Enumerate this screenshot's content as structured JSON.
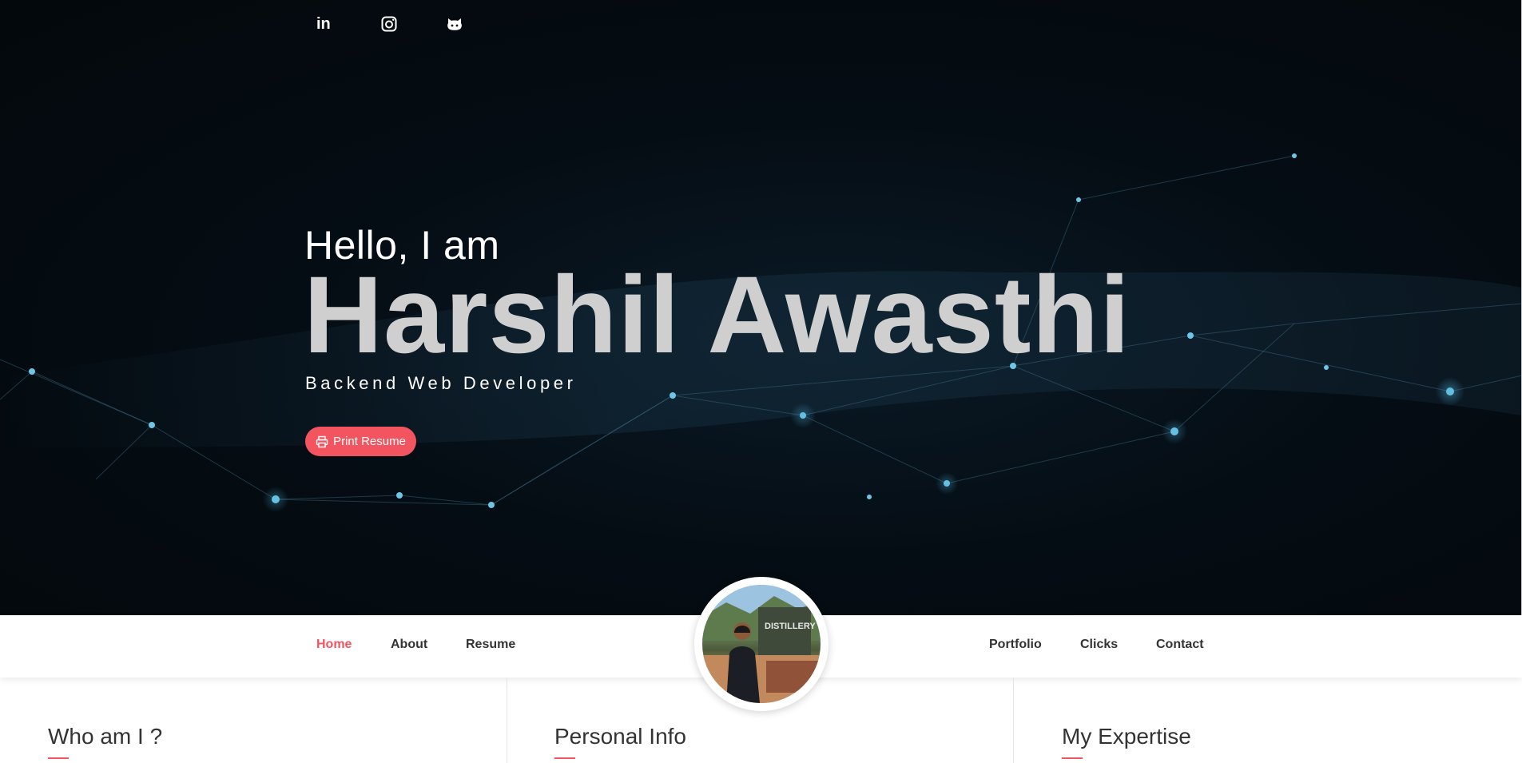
{
  "social": [
    {
      "name": "linkedin-icon",
      "label": "in"
    },
    {
      "name": "instagram-icon",
      "label": ""
    },
    {
      "name": "github-icon",
      "label": ""
    }
  ],
  "hero": {
    "greeting": "Hello, I am",
    "name": "Harshil Awasthi",
    "role": "Backend Web Developer",
    "print_label": "Print Resume"
  },
  "nav": {
    "left": [
      "Home",
      "About",
      "Resume"
    ],
    "right": [
      "Portfolio",
      "Clicks",
      "Contact"
    ],
    "active": "Home"
  },
  "sections": {
    "who": "Who am I ?",
    "personal": "Personal Info",
    "expertise": "My Expertise"
  },
  "colors": {
    "accent": "#f2555f",
    "hero_bg": "#050d14",
    "name_text": "#cfcfcf"
  }
}
